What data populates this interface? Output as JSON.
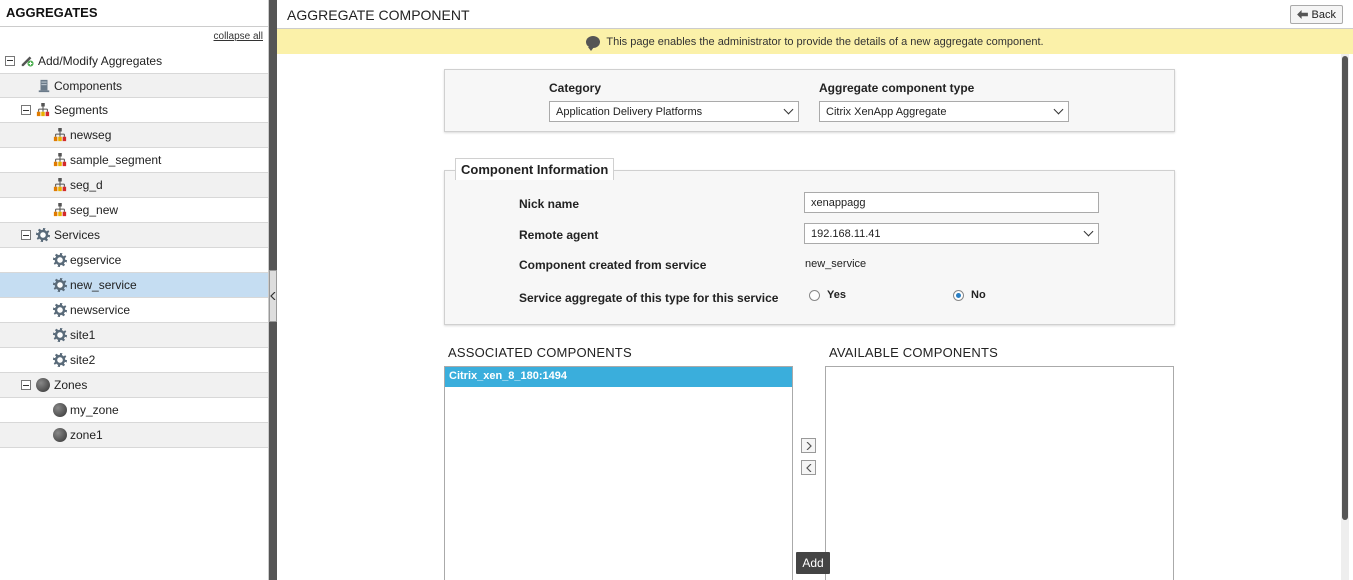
{
  "sidebar": {
    "title": "AGGREGATES",
    "collapse_all": "collapse all",
    "root": "Add/Modify Aggregates",
    "components": "Components",
    "segments": {
      "label": "Segments",
      "items": [
        "newseg",
        "sample_segment",
        "seg_d",
        "seg_new"
      ]
    },
    "services": {
      "label": "Services",
      "items": [
        "egservice",
        "new_service",
        "newservice",
        "site1",
        "site2"
      ],
      "selected": "new_service"
    },
    "zones": {
      "label": "Zones",
      "items": [
        "my_zone",
        "zone1"
      ]
    }
  },
  "header": {
    "title": "AGGREGATE COMPONENT",
    "back_label": "Back"
  },
  "banner": {
    "text": "This page enables the administrator to provide the details of a new aggregate component."
  },
  "selection": {
    "category_label": "Category",
    "category_value": "Application Delivery Platforms",
    "type_label": "Aggregate component type",
    "type_value": "Citrix XenApp Aggregate"
  },
  "component_info": {
    "legend": "Component Information",
    "nick_name_label": "Nick name",
    "nick_name_value": "xenappagg",
    "remote_agent_label": "Remote agent",
    "remote_agent_value": "192.168.11.41",
    "created_from_label": "Component created from service",
    "created_from_value": "new_service",
    "service_aggregate_label": "Service aggregate of this type for this service",
    "yes_label": "Yes",
    "no_label": "No",
    "selected_option": "No"
  },
  "associated": {
    "title": "ASSOCIATED COMPONENTS",
    "items": [
      "Citrix_xen_8_180:1494"
    ]
  },
  "available": {
    "title": "AVAILABLE COMPONENTS",
    "items": []
  },
  "actions": {
    "move_right": ">",
    "move_left": "<",
    "add_label": "Add"
  }
}
